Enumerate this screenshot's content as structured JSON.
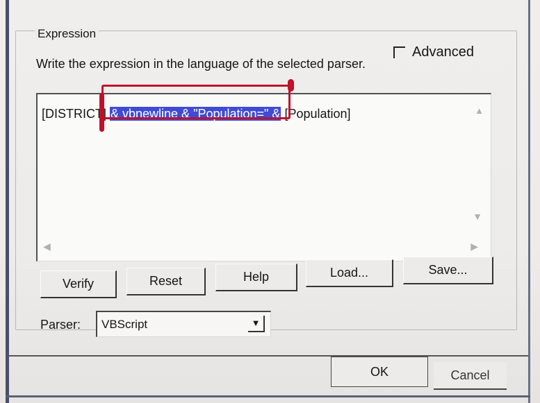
{
  "expression_group": {
    "title": "Expression",
    "instruction": "Write the expression in the language of the selected parser.",
    "advanced_label": "Advanced",
    "advanced_checked": false
  },
  "expression_box": {
    "prefix": "[DISTRICT] ",
    "selected": "& vbnewline & \"Population=\" &",
    "suffix": " [Population]"
  },
  "buttons": {
    "verify": "Verify",
    "reset": "Reset",
    "help": "Help",
    "load": "Load...",
    "save": "Save..."
  },
  "parser": {
    "label": "Parser:",
    "value": "VBScript"
  },
  "footer": {
    "ok": "OK",
    "cancel": "Cancel"
  }
}
